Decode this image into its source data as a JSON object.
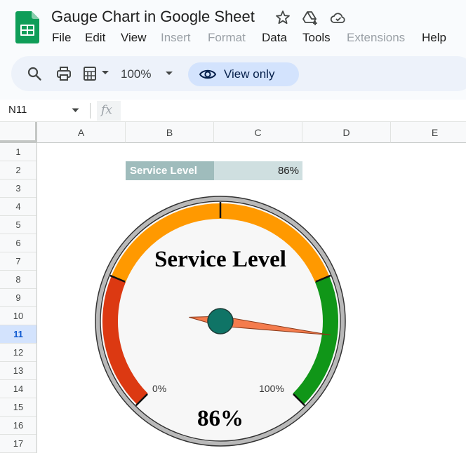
{
  "app": {
    "title": "Gauge Chart in Google Sheet",
    "icons": [
      "sheets-logo",
      "star-icon",
      "move-to-drive-icon",
      "cloud-status-icon"
    ]
  },
  "menu": {
    "items": [
      {
        "label": "File",
        "enabled": true
      },
      {
        "label": "Edit",
        "enabled": true
      },
      {
        "label": "View",
        "enabled": true
      },
      {
        "label": "Insert",
        "enabled": false
      },
      {
        "label": "Format",
        "enabled": false
      },
      {
        "label": "Data",
        "enabled": true
      },
      {
        "label": "Tools",
        "enabled": true
      },
      {
        "label": "Extensions",
        "enabled": false
      },
      {
        "label": "Help",
        "enabled": true
      }
    ]
  },
  "toolbar": {
    "icons": [
      "search-icon",
      "print-icon",
      "paint-format-icon"
    ],
    "zoom": "100%",
    "view_only_label": "View only"
  },
  "formula_bar": {
    "cell_ref": "N11",
    "fx": "fx"
  },
  "grid": {
    "columns": [
      "A",
      "B",
      "C",
      "D",
      "E"
    ],
    "rows": [
      "1",
      "2",
      "3",
      "4",
      "5",
      "6",
      "7",
      "8",
      "9",
      "10",
      "11",
      "12",
      "13",
      "14",
      "15",
      "16",
      "17"
    ],
    "active_row": "11",
    "cells": {
      "B2": "Service Level",
      "C2": "86%"
    }
  },
  "gauge": {
    "title": "Service Level",
    "value_label": "86%",
    "value": 86,
    "min_label": "0%",
    "max_label": "100%",
    "bands": [
      {
        "from": 0,
        "to": 25,
        "color": "#dc3912"
      },
      {
        "from": 25,
        "to": 75,
        "color": "#ff9900"
      },
      {
        "from": 75,
        "to": 100,
        "color": "#109618"
      }
    ],
    "needle_color": "#f47c4d",
    "hub_color": "#0f7466"
  },
  "colors": {
    "sheets_green": "#0f9d58",
    "header_label_bg": "#9fbcbc",
    "header_value_bg": "#cfdfe0",
    "view_only_bg": "#d3e3fd"
  }
}
